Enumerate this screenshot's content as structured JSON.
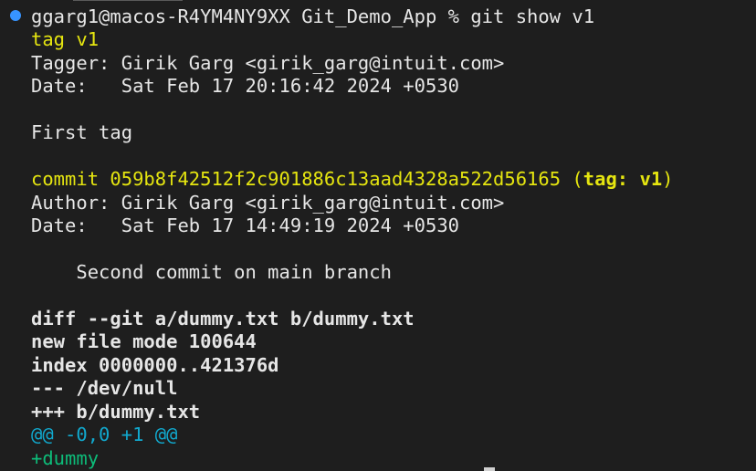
{
  "terminal": {
    "prompt": "ggarg1@macos-R4YM4NY9XX Git_Demo_App % git show v1",
    "tag_line": "tag v1",
    "tagger": "Tagger: Girik Garg <girik_garg@intuit.com>",
    "tag_date": "Date:   Sat Feb 17 20:16:42 2024 +0530",
    "tag_message": "First tag",
    "commit_prefix": "commit 059b8f42512f2c901886c13aad4328a522d56165 (",
    "commit_tag_ref": "tag: v1",
    "commit_suffix": ")",
    "author": "Author: Girik Garg <girik_garg@intuit.com>",
    "commit_date": "Date:   Sat Feb 17 14:49:19 2024 +0530",
    "commit_message": "    Second commit on main branch",
    "diff_header": "diff --git a/dummy.txt b/dummy.txt",
    "file_mode": "new file mode 100644",
    "index_line": "index 0000000..421376d",
    "minus_file": "--- /dev/null",
    "plus_file": "+++ b/dummy.txt",
    "hunk": "@@ -0,0 +1 @@",
    "added_line": "+dummy"
  },
  "colors": {
    "background": "#1e1e1e",
    "foreground": "#e6e6e6",
    "yellow": "#e5e510",
    "cyan": "#11a8cd",
    "green": "#0dbc79",
    "status_dot": "#3794ff"
  }
}
